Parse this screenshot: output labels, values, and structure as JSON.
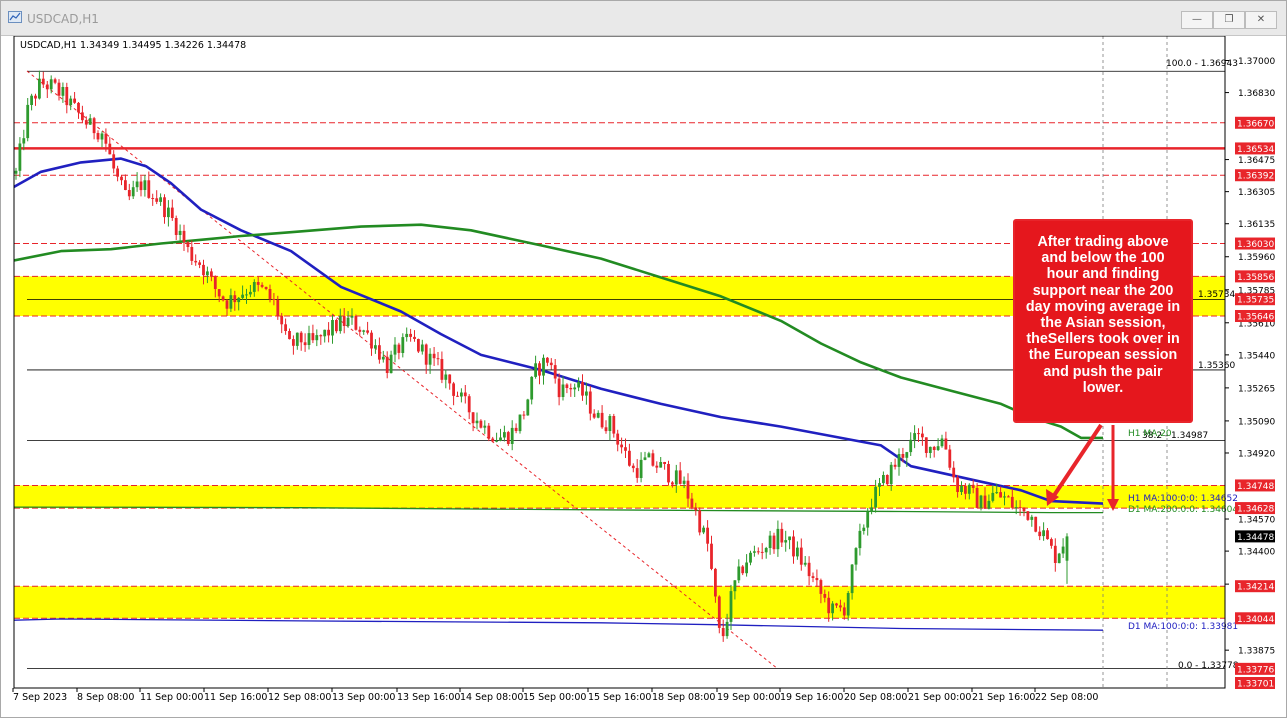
{
  "window": {
    "title": "USDCAD,H1",
    "controls": [
      "minimize-icon",
      "restore-icon",
      "close-icon"
    ]
  },
  "header_info": "USDCAD,H1  1.34349 1.34495 1.34226 1.34478",
  "price_axis": {
    "ticks": [
      "1.37000",
      "1.36830",
      "1.36475",
      "1.36305",
      "1.36135",
      "1.35960",
      "1.35785",
      "1.35610",
      "1.35440",
      "1.35265",
      "1.35090",
      "1.34920",
      "1.34570",
      "1.34400",
      "1.34225",
      "1.33875"
    ],
    "highlighted_labels": [
      {
        "text": "1.36670",
        "color": "#e8252b",
        "value": 1.3667
      },
      {
        "text": "1.36534",
        "color": "#e8252b",
        "value": 1.36534
      },
      {
        "text": "1.36392",
        "color": "#e8252b",
        "value": 1.36392
      },
      {
        "text": "1.36030",
        "color": "#e8252b",
        "value": 1.3603
      },
      {
        "text": "1.35856",
        "color": "#e8252b",
        "value": 1.35856
      },
      {
        "text": "1.35735",
        "color": "#e8252b",
        "value": 1.35735
      },
      {
        "text": "1.35646",
        "color": "#e8252b",
        "value": 1.35646
      },
      {
        "text": "1.34748",
        "color": "#e8252b",
        "value": 1.34748
      },
      {
        "text": "1.34628",
        "color": "#e8252b",
        "value": 1.34628
      },
      {
        "text": "1.34478",
        "color": "#000000",
        "value": 1.34478
      },
      {
        "text": "1.34214",
        "color": "#e8252b",
        "value": 1.34214
      },
      {
        "text": "1.34044",
        "color": "#e8252b",
        "value": 1.34044
      },
      {
        "text": "1.33776",
        "color": "#e8252b",
        "value": 1.33776
      },
      {
        "text": "1.33701",
        "color": "#e8252b",
        "value": 1.33701
      }
    ]
  },
  "time_axis": {
    "labels": [
      "7 Sep 2023",
      "8 Sep 08:00",
      "11 Sep 00:00",
      "11 Sep 16:00",
      "12 Sep 08:00",
      "13 Sep 00:00",
      "13 Sep 16:00",
      "14 Sep 08:00",
      "15 Sep 00:00",
      "15 Sep 16:00",
      "18 Sep 08:00",
      "19 Sep 00:00",
      "19 Sep 16:00",
      "20 Sep 08:00",
      "21 Sep 00:00",
      "21 Sep 16:00",
      "22 Sep 08:00"
    ]
  },
  "chart_labels": {
    "fib_100": "100.0 - 1.36943",
    "fib_382": "38.2 - 1.34987",
    "fib_0": "0.0 - 1.33778",
    "level_35734": "1.35734",
    "level_35360": "1.35360",
    "h1_ma200": "H1 MA:20",
    "h1_ma100": "H1 MA:100:0:0: 1.34652",
    "d1_ma200": "D1 MA:200:0:0: 1.34604",
    "d1_ma100": "D1 MA:100:0:0: 1.33981"
  },
  "annotation": {
    "lines": [
      "After trading above",
      "and below the 100",
      "hour and finding",
      "support near the 200",
      "day moving average in",
      "the Asian session,",
      "theSellers took over in",
      "the European session",
      "and push the pair",
      "lower."
    ]
  },
  "colors": {
    "bull": "#2e9a2e",
    "bear": "#e8252b",
    "ma100": "#2020c0",
    "ma200": "#228b22",
    "zone": "#ffff00",
    "annotation_bg": "#e5171d"
  },
  "chart_data": {
    "type": "candlestick",
    "symbol": "USDCAD",
    "timeframe": "H1",
    "ohlc_last": {
      "open": 1.34349,
      "high": 1.34495,
      "low": 1.34226,
      "close": 1.34478
    },
    "ylim": [
      1.33701,
      1.37
    ],
    "x_labels": [
      "7 Sep 2023",
      "8 Sep 08:00",
      "11 Sep 00:00",
      "11 Sep 16:00",
      "12 Sep 08:00",
      "13 Sep 00:00",
      "13 Sep 16:00",
      "14 Sep 08:00",
      "15 Sep 00:00",
      "15 Sep 16:00",
      "18 Sep 08:00",
      "19 Sep 00:00",
      "19 Sep 16:00",
      "20 Sep 08:00",
      "21 Sep 00:00",
      "21 Sep 16:00",
      "22 Sep 08:00"
    ],
    "close_path": [
      1.364,
      1.3675,
      1.3688,
      1.3686,
      1.368,
      1.3672,
      1.3665,
      1.3662,
      1.364,
      1.3625,
      1.3635,
      1.363,
      1.3622,
      1.3612,
      1.3598,
      1.3592,
      1.358,
      1.3572,
      1.3576,
      1.358,
      1.3578,
      1.357,
      1.3548,
      1.3552,
      1.355,
      1.3555,
      1.356,
      1.3562,
      1.3558,
      1.355,
      1.3538,
      1.3548,
      1.3552,
      1.3545,
      1.3538,
      1.353,
      1.352,
      1.3512,
      1.3505,
      1.35,
      1.3502,
      1.3512,
      1.3535,
      1.3542,
      1.3525,
      1.3528,
      1.3522,
      1.351,
      1.3508,
      1.3495,
      1.3482,
      1.3488,
      1.3485,
      1.348,
      1.3475,
      1.346,
      1.3442,
      1.339,
      1.342,
      1.3435,
      1.344,
      1.3445,
      1.3448,
      1.344,
      1.343,
      1.3418,
      1.3408,
      1.341,
      1.344,
      1.3465,
      1.3475,
      1.3485,
      1.3495,
      1.35,
      1.3495,
      1.35,
      1.3475,
      1.3472,
      1.3465,
      1.347,
      1.3468,
      1.3462,
      1.346,
      1.345,
      1.3437,
      1.34478
    ],
    "horizontal_levels": [
      {
        "label": "100.0 - 1.36943",
        "value": 1.36943,
        "color": "#000000"
      },
      {
        "label": "1.36670",
        "value": 1.3667,
        "color": "#e8252b",
        "style": "dashed"
      },
      {
        "label": "1.36534",
        "value": 1.36534,
        "color": "#e8252b",
        "style": "solid"
      },
      {
        "label": "1.36392",
        "value": 1.36392,
        "color": "#e8252b",
        "style": "dashed"
      },
      {
        "label": "1.36030",
        "value": 1.3603,
        "color": "#e8252b",
        "style": "dashed"
      },
      {
        "label": "1.35734",
        "value": 1.35734,
        "color": "#000000"
      },
      {
        "label": "1.35360",
        "value": 1.3536,
        "color": "#000000"
      },
      {
        "label": "38.2 - 1.34987",
        "value": 1.34987,
        "color": "#000000"
      },
      {
        "label": "0.0 - 1.33778",
        "value": 1.33778,
        "color": "#000000"
      }
    ],
    "zones": [
      {
        "from": 1.35646,
        "to": 1.35856,
        "color": "#ffff00"
      },
      {
        "from": 1.34628,
        "to": 1.34748,
        "color": "#ffff00"
      },
      {
        "from": 1.34044,
        "to": 1.34214,
        "color": "#ffff00"
      }
    ],
    "series": [
      {
        "name": "H1 MA:100",
        "points": [
          1.3633,
          1.3641,
          1.3646,
          1.3648,
          1.3644,
          1.3635,
          1.3621,
          1.361,
          1.3599,
          1.358,
          1.3567,
          1.3555,
          1.3544,
          1.3536,
          1.3526,
          1.3518,
          1.3511,
          1.3506,
          1.3501,
          1.3496,
          1.3485,
          1.34768,
          1.34722,
          1.34665,
          1.34652
        ],
        "current": 1.34652
      },
      {
        "name": "H1 MA:200",
        "points": [
          1.3594,
          1.3599,
          1.36,
          1.3603,
          1.3605,
          1.3607,
          1.3609,
          1.3612,
          1.3613,
          1.361,
          1.3602,
          1.3595,
          1.3585,
          1.3575,
          1.3562,
          1.355,
          1.354,
          1.3532,
          1.3525,
          1.3518,
          1.3511,
          1.3506,
          1.35,
          1.35
        ]
      },
      {
        "name": "D1 MA:200",
        "points": [
          1.34633,
          1.34632,
          1.3463,
          1.34622,
          1.34615,
          1.3461,
          1.34604,
          1.34604
        ],
        "current": 1.34604
      },
      {
        "name": "D1 MA:100",
        "points": [
          1.34034,
          1.3404,
          1.3403,
          1.3402,
          1.3401,
          1.3399,
          1.33981
        ],
        "current": 1.33981
      }
    ]
  }
}
